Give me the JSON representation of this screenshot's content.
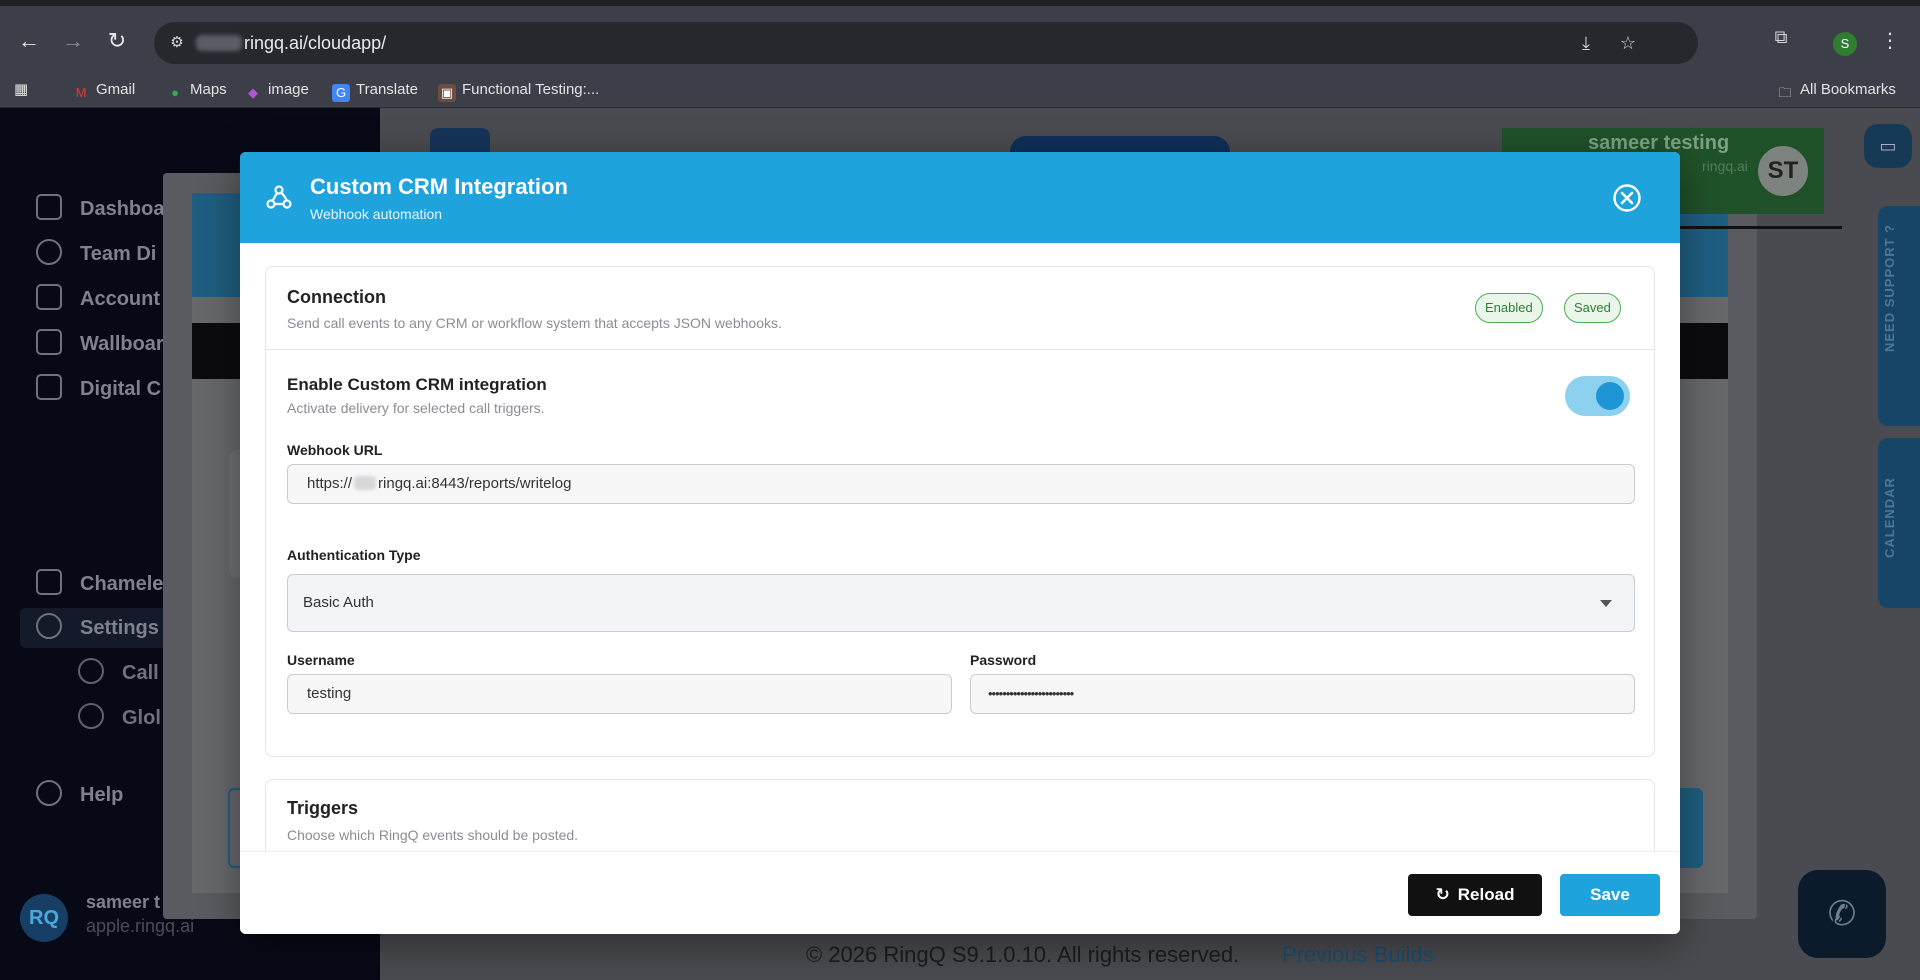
{
  "browser": {
    "url": "ringq.ai/cloudapp/",
    "avatar_letter": "S",
    "bookmarks": [
      {
        "label": "Gmail"
      },
      {
        "label": "Maps"
      },
      {
        "label": "image"
      },
      {
        "label": "Translate"
      },
      {
        "label": "Functional Testing:..."
      }
    ],
    "all_bookmarks": "All Bookmarks"
  },
  "sidebar": {
    "items": [
      {
        "label": "Dashboa"
      },
      {
        "label": "Team Di"
      },
      {
        "label": "Account"
      },
      {
        "label": "Wallboar"
      },
      {
        "label": "Digital C"
      },
      {
        "label": "Chamele"
      },
      {
        "label": "Settings"
      },
      {
        "label": "Help"
      }
    ],
    "sub_items": [
      {
        "label": "Call"
      },
      {
        "label": "Glol"
      }
    ],
    "user_name": "sameer t",
    "user_domain": "apple.ringq.ai",
    "user_initials": "RQ"
  },
  "topbar": {
    "user_name": "sameer testing",
    "user_domain": "ringq.ai",
    "user_initials": "ST"
  },
  "side_tabs": {
    "support": "NEED SUPPORT ?",
    "calendar": "CALENDAR"
  },
  "footer": {
    "copyright": "© 2026 RingQ S9.1.0.10. All rights reserved.",
    "link": "Previous Builds"
  },
  "modal": {
    "title": "Custom CRM Integration",
    "subtitle": "Webhook automation",
    "connection": {
      "title": "Connection",
      "description": "Send call events to any CRM or workflow system that accepts JSON webhooks.",
      "badges": [
        "Enabled",
        "Saved"
      ],
      "enable_title": "Enable Custom CRM integration",
      "enable_description": "Activate delivery for selected call triggers.",
      "enabled": true,
      "webhook_label": "Webhook URL",
      "webhook_prefix": "https://",
      "webhook_suffix": "ringq.ai:8443/reports/writelog",
      "auth_label": "Authentication Type",
      "auth_value": "Basic Auth",
      "username_label": "Username",
      "username_value": "testing",
      "password_label": "Password",
      "password_value": "••••••••••••••••••••••••"
    },
    "triggers": {
      "title": "Triggers",
      "description": "Choose which RingQ events should be posted."
    },
    "buttons": {
      "reload": "Reload",
      "save": "Save"
    }
  },
  "colors": {
    "header_blue": "#1fa3dd",
    "badge_green": "#2e7d32",
    "reload_black": "#111111"
  }
}
